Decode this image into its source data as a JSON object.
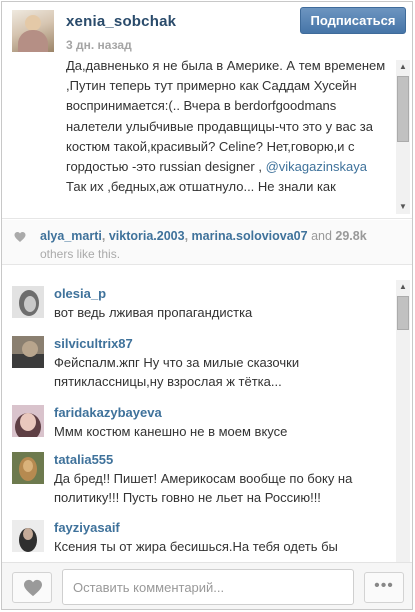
{
  "post": {
    "username": "xenia_sobchak",
    "timestamp": "3 дн. назад",
    "follow_label": "Подписаться",
    "caption_parts": [
      "Да,давненько я не была в Америке. А тем временем ,Путин теперь тут примерно как Саддам Хусейн воспринимается:(.. Вчера в berdorfgoodmans налетели улыбчивые продавщицы-что это у вас за костюм такой,красивый? Celine? Нет,говорю,и с гордостью -это russian designer ,",
      "@vikagazinskaya",
      "Так их ,бедных,аж отшатнуло... Не знали как"
    ]
  },
  "likes": {
    "users": [
      "alya_marti",
      "viktoria.2003",
      "marina.soloviova07"
    ],
    "separator": ",",
    "and_word": "and",
    "count": "29.8k",
    "others_text": "others like this."
  },
  "comments": [
    {
      "user": "olesia_p",
      "text": "вот ведь лживая пропагандистка"
    },
    {
      "user": "silvicultrix87",
      "text": "Фейспалм.жпг Ну что за милые сказочки пятиклассницы,ну взрослая ж тётка..."
    },
    {
      "user": "faridakazybayeva",
      "text": "Ммм костюм канешно не в моем вкусе"
    },
    {
      "user": "tatalia555",
      "text": "Да бред!! Пишет! Америкосам вообще по боку на политику!!! Пусть говно не льет на Россию!!!"
    },
    {
      "user": "fayziyasaif",
      "text": "Ксения ты от жира бесишься.На тебя одеть бы"
    }
  ],
  "footer": {
    "comment_placeholder": "Оставить комментарий...",
    "more_label": "•••"
  },
  "icons": {
    "heart": "heart-icon",
    "more": "more-icon"
  },
  "colors": {
    "link": "#3f729b",
    "username": "#2a4b6b",
    "follow_button": "#4675a8"
  }
}
